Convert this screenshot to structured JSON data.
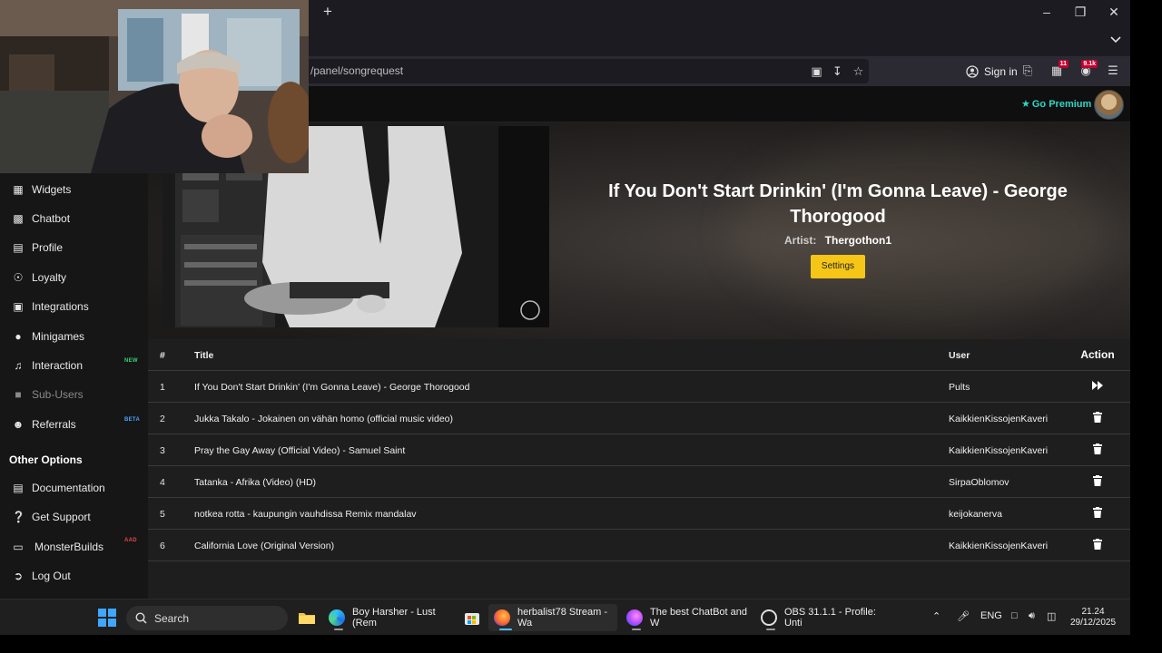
{
  "browser": {
    "url": "/panel/songrequest",
    "new_tab_icon": "plus-icon",
    "sign_in_label": "Sign in",
    "ext_badge_1": "11",
    "ext_badge_2": "9.1k"
  },
  "site": {
    "premium_label": "Go Premium",
    "premium_icon": "star-icon",
    "accent_color": "#2fd6c7"
  },
  "sidebar": {
    "items": [
      {
        "label": "Widgets",
        "icon": "widgets-icon"
      },
      {
        "label": "Chatbot",
        "icon": "robot-icon"
      },
      {
        "label": "Profile",
        "icon": "id-card-icon"
      },
      {
        "label": "Loyalty",
        "icon": "trophy-icon"
      },
      {
        "label": "Integrations",
        "icon": "integrations-icon"
      },
      {
        "label": "Minigames",
        "icon": "gamepad-icon"
      },
      {
        "label": "Interaction",
        "icon": "music-note-icon",
        "badge": "NEW"
      },
      {
        "label": "Sub-Users",
        "icon": "sub-users-icon"
      },
      {
        "label": "Referrals",
        "icon": "users-icon",
        "badge": "BETA"
      }
    ],
    "other_heading": "Other Options",
    "other_items": [
      {
        "label": "Documentation",
        "icon": "book-icon"
      },
      {
        "label": "Get Support",
        "icon": "question-icon"
      },
      {
        "label": "MonsterBuilds",
        "icon": "laptop-icon",
        "badge": "AAD"
      },
      {
        "label": "Log Out",
        "icon": "logout-icon"
      }
    ]
  },
  "now_playing": {
    "title": "If You Don't Start Drinkin' (I'm Gonna Leave) - George Thorogood",
    "artist_label": "Artist:",
    "artist": "Thergothon1",
    "settings_label": "Settings",
    "settings_color": "#f5c518"
  },
  "queue": {
    "headers": {
      "num": "#",
      "title": "Title",
      "user": "User",
      "action": "Action"
    },
    "rows": [
      {
        "num": "1",
        "title": "If You Don't Start Drinkin' (I'm Gonna Leave) - George Thorogood",
        "user": "Pults",
        "action_icon": "skip-forward-icon"
      },
      {
        "num": "2",
        "title": "Jukka Takalo - Jokainen on vähän homo (official music video)",
        "user": "KaikkienKissojenKaveri",
        "action_icon": "trash-icon"
      },
      {
        "num": "3",
        "title": "Pray the Gay Away (Official Video) - Samuel Saint",
        "user": "KaikkienKissojenKaveri",
        "action_icon": "trash-icon"
      },
      {
        "num": "4",
        "title": "Tatanka - Afrika (Video) (HD)",
        "user": "SirpaOblomov",
        "action_icon": "trash-icon"
      },
      {
        "num": "5",
        "title": "notkea rotta - kaupungin vauhdissa Remix mandalav",
        "user": "keijokanerva",
        "action_icon": "trash-icon"
      },
      {
        "num": "6",
        "title": "California Love (Original Version)",
        "user": "KaikkienKissojenKaveri",
        "action_icon": "trash-icon"
      }
    ]
  },
  "taskbar": {
    "search_label": "Search",
    "tasks": [
      {
        "label": "Boy Harsher - Lust (Rem",
        "icon": "edge-icon"
      },
      {
        "label": "herbalist78 Stream - Wa",
        "icon": "firefox-icon"
      },
      {
        "label": "The best ChatBot and W",
        "icon": "firefox-dev-icon"
      },
      {
        "label": "OBS 31.1.1 - Profile: Unti",
        "icon": "obs-icon"
      }
    ],
    "language": "ENG",
    "time": "21.24",
    "date": "29/12/2025"
  }
}
